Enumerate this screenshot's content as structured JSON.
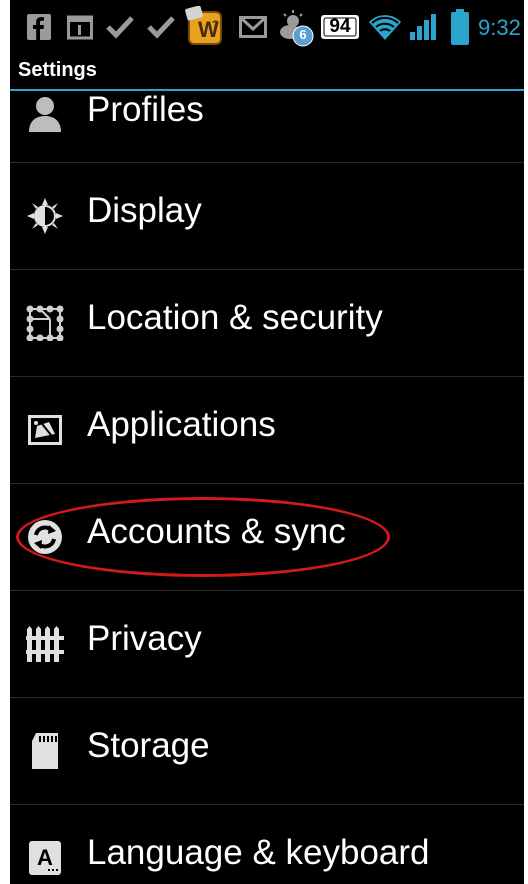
{
  "status_bar": {
    "time": "9:32",
    "battery_badge": "94",
    "notification_count": "6",
    "icons": [
      "facebook-icon",
      "calendar-icon",
      "check-icon",
      "check-icon",
      "words-with-friends-icon",
      "gmail-icon",
      "weather-icon",
      "battery-badge-icon",
      "wifi-icon",
      "signal-icon",
      "battery-icon"
    ]
  },
  "title_bar": {
    "title": "Settings"
  },
  "settings": {
    "items": [
      {
        "label": "Profiles",
        "icon": "profile-icon"
      },
      {
        "label": "Display",
        "icon": "display-icon"
      },
      {
        "label": "Location & security",
        "icon": "location-security-icon"
      },
      {
        "label": "Applications",
        "icon": "applications-icon"
      },
      {
        "label": "Accounts & sync",
        "icon": "sync-icon"
      },
      {
        "label": "Privacy",
        "icon": "privacy-icon"
      },
      {
        "label": "Storage",
        "icon": "sd-card-icon"
      },
      {
        "label": "Language & keyboard",
        "icon": "keyboard-icon"
      }
    ],
    "highlighted_item": "Accounts & sync"
  },
  "colors": {
    "accent": "#2ba5cc",
    "highlight": "#d11a1a",
    "background": "#000000",
    "text": "#ffffff"
  }
}
